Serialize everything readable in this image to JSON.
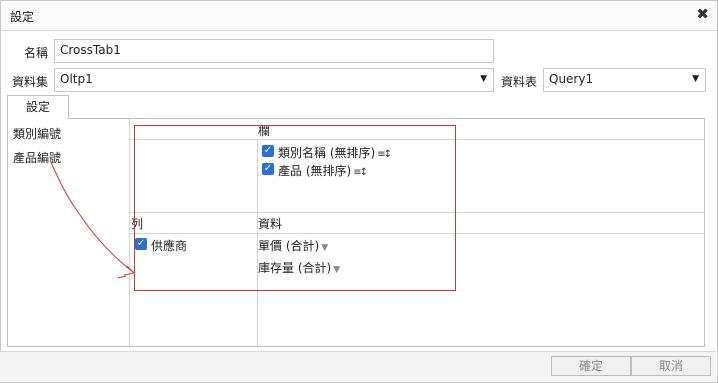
{
  "dialog": {
    "title": "設定",
    "close_symbol": "✖"
  },
  "form": {
    "name_label": "名稱",
    "name_value": "CrossTab1",
    "dataset_label": "資料集",
    "dataset_value": "Oltp1",
    "datatable_label": "資料表",
    "datatable_value": "Query1"
  },
  "tab": {
    "label": "設定"
  },
  "fields": [
    "類別編號",
    "產品編號"
  ],
  "columns_section": {
    "header": "欄",
    "items": [
      {
        "label": "類別名稱 (無排序)",
        "checked": true,
        "icon": "sort-icon"
      },
      {
        "label": "產品 (無排序)",
        "checked": true,
        "icon": "sort-icon"
      }
    ]
  },
  "rows_section": {
    "header": "列",
    "items": [
      {
        "label": "供應商",
        "checked": true
      }
    ]
  },
  "data_section": {
    "header": "資料",
    "items": [
      {
        "label": "單價 (合計)",
        "icon": "dropdown-icon"
      },
      {
        "label": "庫存量 (合計)",
        "icon": "dropdown-icon"
      }
    ]
  },
  "buttons": {
    "ok": "確定",
    "cancel": "取消"
  },
  "colors": {
    "accent_checkbox": "#2a6fd6",
    "annotation": "#c83a3a"
  }
}
